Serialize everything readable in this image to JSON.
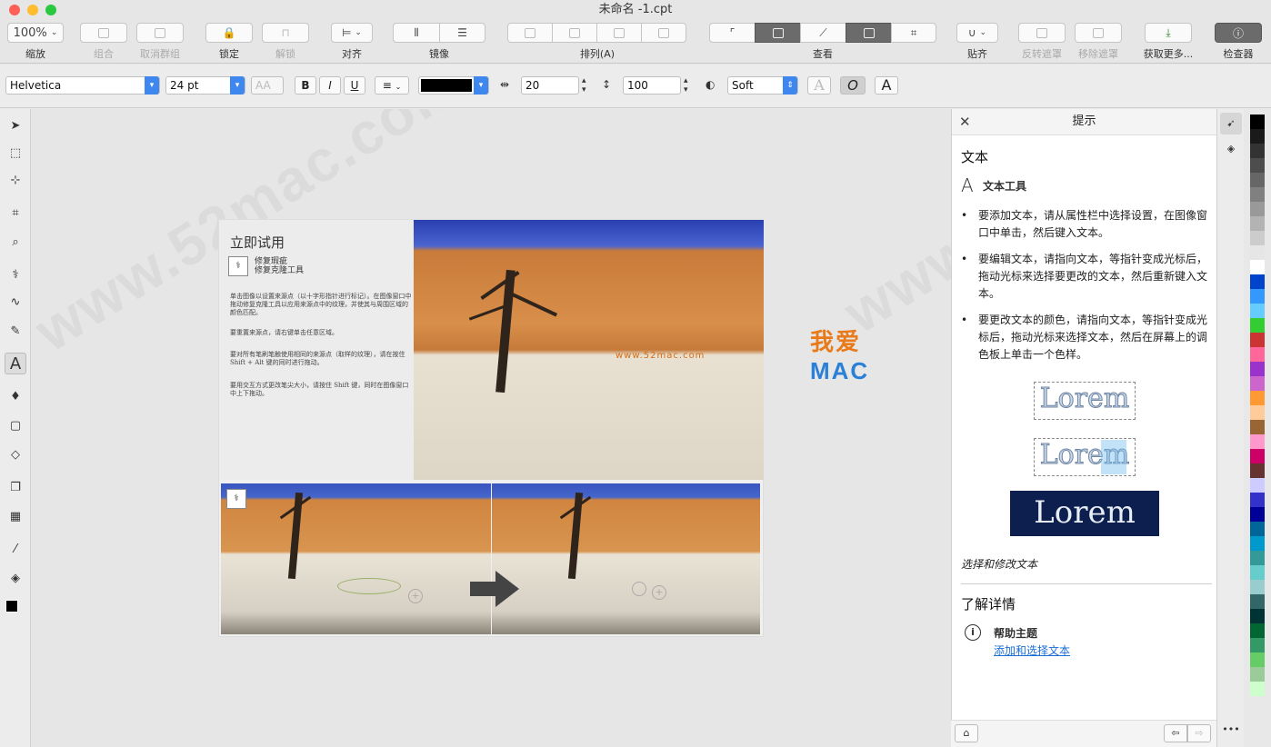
{
  "window": {
    "title": "未命名 -1.cpt"
  },
  "toolbar": {
    "zoom_value": "100%",
    "zoom_label": "缩放",
    "group_label": "组合",
    "ungroup_label": "取消群组",
    "lock_label": "锁定",
    "unlock_label": "解锁",
    "align_label": "对齐",
    "mirror_label": "镜像",
    "arrange_label": "排列(A)",
    "view_label": "查看",
    "snap_label": "贴齐",
    "invert_mask_label": "反转遮罩",
    "remove_mask_label": "移除遮罩",
    "get_more_label": "获取更多...",
    "inspector_label": "检查器"
  },
  "propbar": {
    "font_family": "Helvetica",
    "font_size": "24 pt",
    "font_style_placeholder": "AA",
    "bold": "B",
    "italic": "I",
    "underline": "U",
    "char_spacing": "20",
    "line_spacing": "100",
    "antialias": "Soft",
    "text_outline_letter": "A",
    "text_italic_letter": "O",
    "text_plain_letter": "A"
  },
  "document": {
    "title": "立即试用",
    "subtitle": "修复瑕疵\n修复克隆工具",
    "para1": "单击图像以设置来源点（以十字形指针进行标记）。在图像窗口中拖动修复克隆工具以应用来源点中的纹理，并使其与周围区域的颜色匹配。",
    "para2": "要重置来源点，请右键单击任意区域。",
    "para3": "要对所有笔刷笔触使用相同的来源点（取样的纹理），请在按住 Shift + Alt 键的同时进行拖动。",
    "para4": "要用交互方式更改笔尖大小，请按住 Shift 键，同时在图像窗口中上下拖动。",
    "mac_cn": "我爱",
    "mac_en": "MAC",
    "mac_url": "www.52mac.com"
  },
  "watermark": {
    "text": "www.52mac.com"
  },
  "hints": {
    "header": "提示",
    "section_title": "文本",
    "tool_name": "文本工具",
    "bullets": [
      "要添加文本，请从属性栏中选择设置，在图像窗口中单击，然后键入文本。",
      "要编辑文本，请指向文本，等指针变成光标后，拖动光标来选择要更改的文本，然后重新键入文本。",
      "要更改文本的颜色，请指向文本，等指针变成光标后，拖动光标来选择文本，然后在屏幕上的调色板上单击一个色样。"
    ],
    "lorem": "Lorem",
    "caption": "选择和修改文本",
    "learn_more": "了解详情",
    "help_topic": "帮助主题",
    "help_link": "添加和选择文本"
  },
  "palette_colors": [
    "#000000",
    "#1a1a1a",
    "#333333",
    "#4d4d4d",
    "#666666",
    "#808080",
    "#999999",
    "#b3b3b3",
    "#cccccc",
    "#e6e6e6",
    "#ffffff",
    "#0044cc",
    "#3399ff",
    "#66ccff",
    "#33cc33",
    "#cc3333",
    "#ff6699",
    "#9933cc",
    "#cc66cc",
    "#ff9933",
    "#ffcc99",
    "#996633",
    "#ff99cc",
    "#cc0066",
    "#663333",
    "#ccccff",
    "#3333cc",
    "#000099",
    "#006699",
    "#0099cc",
    "#339999",
    "#66cccc",
    "#99cccc",
    "#336666",
    "#003333",
    "#006633",
    "#339966",
    "#66cc66",
    "#99cc99",
    "#ccffcc"
  ]
}
